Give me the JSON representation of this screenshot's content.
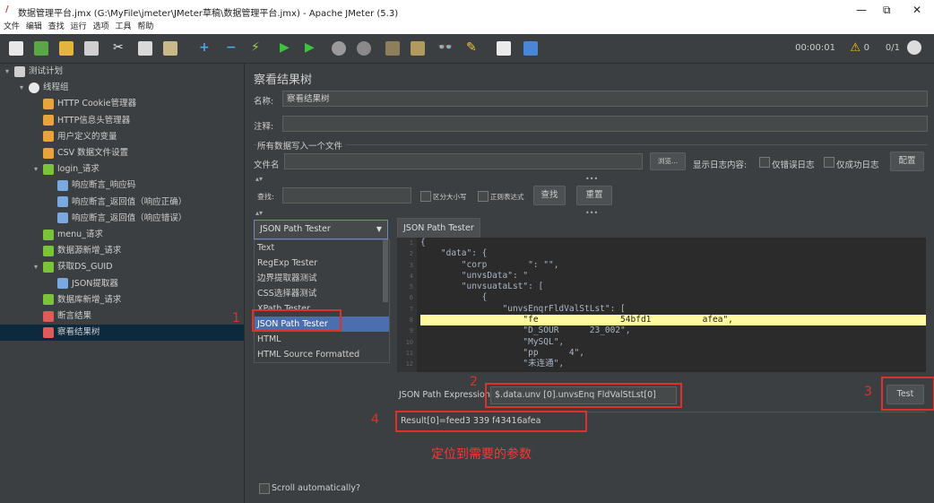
{
  "window": {
    "title": "数据管理平台.jmx (G:\\MyFile\\jmeter\\JMeter草稿\\数据管理平台.jmx) - Apache JMeter (5.3)",
    "minimize": "—",
    "maximize": "⧉",
    "close": "✕"
  },
  "menu": [
    "文件",
    "编辑",
    "查找",
    "运行",
    "选项",
    "工具",
    "帮助"
  ],
  "status": {
    "elapsed": "00:00:01",
    "warnings": "0",
    "threads": "0/1"
  },
  "tree": {
    "nodes": [
      {
        "label": "测试计划",
        "indent": 0,
        "arrow": "▾",
        "icon": "test-plan-icon"
      },
      {
        "label": "线程组",
        "indent": 1,
        "arrow": "▾",
        "icon": "gear-icon"
      },
      {
        "label": "HTTP Cookie管理器",
        "indent": 2,
        "arrow": "",
        "icon": "wrench-icon"
      },
      {
        "label": "HTTP信息头管理器",
        "indent": 2,
        "arrow": "",
        "icon": "wrench-icon"
      },
      {
        "label": "用户定义的变量",
        "indent": 2,
        "arrow": "",
        "icon": "wrench-icon"
      },
      {
        "label": "CSV 数据文件设置",
        "indent": 2,
        "arrow": "",
        "icon": "wrench-icon"
      },
      {
        "label": "login_请求",
        "indent": 2,
        "arrow": "▾",
        "icon": "pen-icon"
      },
      {
        "label": "响应断言_响应码",
        "indent": 3,
        "arrow": "",
        "icon": "assertion-icon"
      },
      {
        "label": "响应断言_返回值（响应正确）",
        "indent": 3,
        "arrow": "",
        "icon": "assertion-icon"
      },
      {
        "label": "响应断言_返回值（响应错误）",
        "indent": 3,
        "arrow": "",
        "icon": "assertion-icon"
      },
      {
        "label": "menu_请求",
        "indent": 2,
        "arrow": "",
        "icon": "pen-icon"
      },
      {
        "label": "数据源新增_请求",
        "indent": 2,
        "arrow": "",
        "icon": "pen-icon"
      },
      {
        "label": "获取DS_GUID",
        "indent": 2,
        "arrow": "▾",
        "icon": "pen-icon"
      },
      {
        "label": "JSON提取器",
        "indent": 3,
        "arrow": "",
        "icon": "extractor-icon"
      },
      {
        "label": "数据库新增_请求",
        "indent": 2,
        "arrow": "",
        "icon": "pen-icon"
      },
      {
        "label": "断言结果",
        "indent": 2,
        "arrow": "",
        "icon": "chart-icon"
      },
      {
        "label": "察看结果树",
        "indent": 2,
        "arrow": "",
        "icon": "chart-icon",
        "selected": true
      }
    ]
  },
  "panel": {
    "title": "察看结果树",
    "name_label": "名称:",
    "name_value": "察看结果树",
    "comment_label": "注释:",
    "comment_value": "",
    "file_group": "所有数据写入一个文件",
    "file_label": "文件名",
    "browse": "浏览...",
    "log_display": "显示日志内容:",
    "errors_only": "仅错误日志",
    "success_only": "仅成功日志",
    "configure": "配置",
    "search_label": "查找:",
    "case_sensitive": "区分大小写",
    "regex": "正则表达式",
    "find": "查找",
    "reset": "重置"
  },
  "renderer": {
    "selected": "JSON Path Tester",
    "options": [
      "Text",
      "RegExp Tester",
      "边界提取器测试",
      "CSS选择器测试",
      "XPath Tester",
      "JSON Path Tester",
      "HTML",
      "HTML Source Formatted"
    ],
    "scroll_auto": "Scroll automatically?"
  },
  "tester": {
    "tab": "JSON Path Tester",
    "lines": [
      "1",
      "2",
      "3",
      "4",
      "5",
      "6",
      "7",
      "8",
      "9",
      "10",
      "11",
      "12"
    ],
    "code": [
      "{",
      "    \"data\": {",
      "        \"corp        \": \"\",",
      "        \"unvsData\": \"",
      "        \"unvsuataLst\": [",
      "            {",
      "                \"unvsEnqrFldValStLst\": [",
      "                    \"fe                54bfd1          afea\",",
      "                    \"D_SOUR      23_002\",",
      "                    \"MySQL\",",
      "                    \"pp      4\",",
      "                    \"未连通\","
    ],
    "expression_label": "JSON Path Expression",
    "expression_value": "$.data.unv                 [0].unvsEnq   FldValStLst[0]",
    "test_button": "Test",
    "result": "Result[0]=feed3        339                   f43416afea"
  },
  "annotations": {
    "n1": "1",
    "n2": "2",
    "n3": "3",
    "n4": "4",
    "caption": "定位到需要的参数",
    "color": "#e0302b"
  }
}
